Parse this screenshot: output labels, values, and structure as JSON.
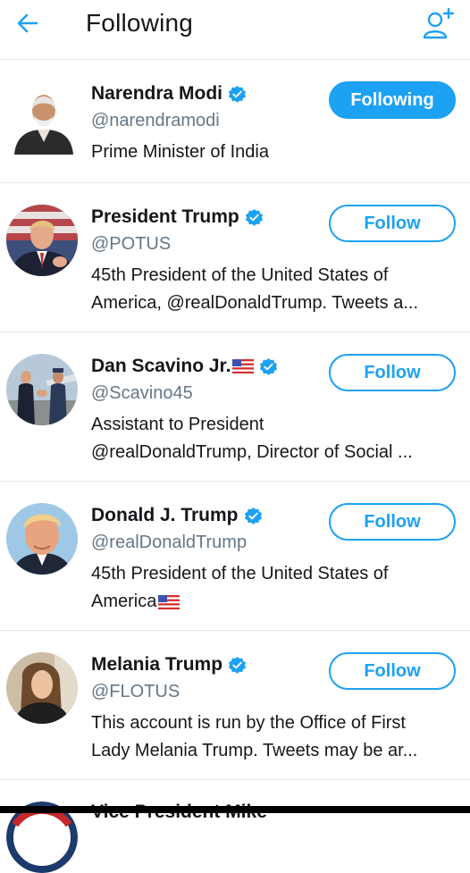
{
  "header": {
    "title": "Following",
    "back_icon": "arrow-left-icon",
    "add_icon": "add-user-icon"
  },
  "colors": {
    "accent": "#1da1f2",
    "text": "#14171a",
    "secondary": "#657786",
    "divider": "#e1e8ed"
  },
  "users": [
    {
      "name": "Narendra Modi",
      "handle": "@narendramodi",
      "bio": [
        "Prime Minister of India"
      ],
      "button": "Following",
      "following": true
    },
    {
      "name": "President Trump",
      "handle": "@POTUS",
      "bio": [
        "45th President of the United States of",
        "America, @realDonaldTrump. Tweets a..."
      ],
      "button": "Follow",
      "following": false
    },
    {
      "name": "Dan Scavino Jr.",
      "handle": "@Scavino45",
      "bio": [
        "Assistant to President",
        "@realDonaldTrump, Director of Social ..."
      ],
      "button": "Follow",
      "following": false
    },
    {
      "name": "Donald J. Trump",
      "handle": "@realDonaldTrump",
      "bio": [
        "45th President of the United States of",
        "America"
      ],
      "button": "Follow",
      "following": false
    },
    {
      "name": "Melania Trump",
      "handle": "@FLOTUS",
      "bio": [
        "This account is run by the Office of First",
        "Lady Melania Trump. Tweets may be ar..."
      ],
      "button": "Follow",
      "following": false
    }
  ],
  "peek": {
    "name": "Vice President Mike"
  }
}
